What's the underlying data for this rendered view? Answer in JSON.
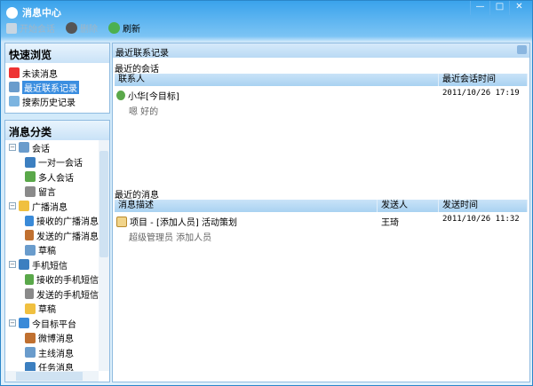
{
  "window": {
    "title": "消息中心",
    "controls": [
      "minimize",
      "maximize",
      "close"
    ]
  },
  "toolbar": {
    "start_chat": "开始会话",
    "delete": "删除",
    "refresh": "刷新"
  },
  "quick": {
    "title": "快速浏览",
    "items": [
      {
        "label": "未读消息",
        "icon": "unread-icon"
      },
      {
        "label": "最近联系记录",
        "icon": "recent-icon",
        "selected": true
      },
      {
        "label": "搜索历史记录",
        "icon": "search-icon"
      }
    ]
  },
  "category": {
    "title": "消息分类",
    "nodes": [
      {
        "label": "会话",
        "level": 0,
        "icon": "chat-icon"
      },
      {
        "label": "一对一会话",
        "level": 1,
        "icon": "user-icon"
      },
      {
        "label": "多人会话",
        "level": 1,
        "icon": "group-icon"
      },
      {
        "label": "留言",
        "level": 1,
        "icon": "note-icon"
      },
      {
        "label": "广播消息",
        "level": 0,
        "icon": "broadcast-icon"
      },
      {
        "label": "接收的广播消息",
        "level": 1,
        "icon": "broadcast-in-icon"
      },
      {
        "label": "发送的广播消息",
        "level": 1,
        "icon": "broadcast-out-icon"
      },
      {
        "label": "草稿",
        "level": 1,
        "icon": "draft-icon"
      },
      {
        "label": "手机短信",
        "level": 0,
        "icon": "phone-icon"
      },
      {
        "label": "接收的手机短信",
        "level": 1,
        "icon": "sms-in-icon"
      },
      {
        "label": "发送的手机短信",
        "level": 1,
        "icon": "sms-out-icon"
      },
      {
        "label": "草稿",
        "level": 1,
        "icon": "draft-icon"
      },
      {
        "label": "今目标平台",
        "level": 0,
        "icon": "platform-icon"
      },
      {
        "label": "微博消息",
        "level": 1,
        "icon": "weibo-icon"
      },
      {
        "label": "主线消息",
        "level": 1,
        "icon": "mainline-icon"
      },
      {
        "label": "任务消息",
        "level": 1,
        "icon": "task-icon"
      }
    ]
  },
  "main": {
    "title": "最近联系记录",
    "conversations": {
      "title": "最近的会话",
      "columns": [
        "联系人",
        "最近会话时间"
      ],
      "rows": [
        {
          "contact": "小华[今目标]",
          "preview": "嗯 好的",
          "time": "2011/10/26 17:19"
        }
      ]
    },
    "messages": {
      "title": "最近的消息",
      "columns": [
        "消息描述",
        "发送人",
        "发送时间"
      ],
      "rows": [
        {
          "desc": "项目 - [添加人员] 活动策划",
          "sub": "超级管理员 添加人员",
          "sender": "王琦",
          "time": "2011/10/26 11:32"
        }
      ]
    }
  },
  "colors": {
    "accent": "#3b8ee0",
    "title_bar": "#3aa3ec"
  }
}
